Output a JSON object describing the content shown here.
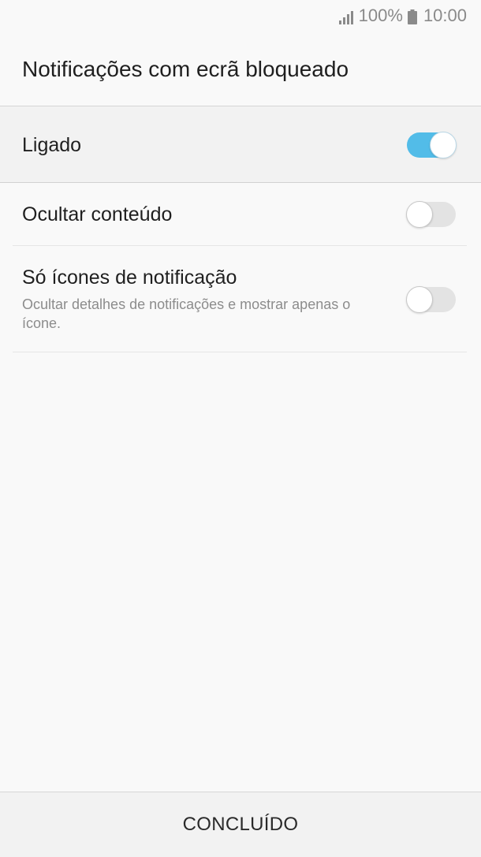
{
  "status_bar": {
    "signal_icon": "signal-strength-icon",
    "battery_percent": "100%",
    "battery_icon": "battery-full-icon",
    "time": "10:00"
  },
  "header": {
    "title": "Notificações com ecrã bloqueado"
  },
  "master_switch": {
    "label": "Ligado",
    "state": "on",
    "accent_color": "#52bce8"
  },
  "settings": [
    {
      "label": "Ocultar conteúdo",
      "state": "off"
    },
    {
      "label": "Só ícones de notificação",
      "description": "Ocultar detalhes de notificações e mostrar apenas o ícone.",
      "state": "off"
    }
  ],
  "footer": {
    "done_label": "CONCLUÍDO"
  }
}
